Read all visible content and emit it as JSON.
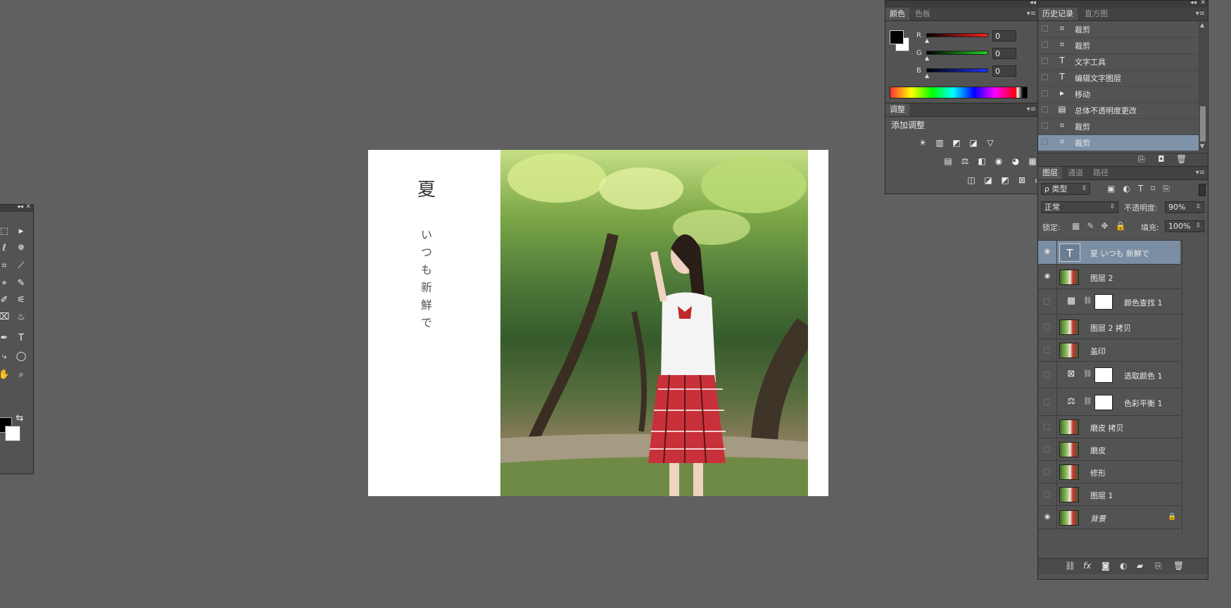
{
  "toolbar": {
    "tools": [
      "⬚",
      "▸",
      "ℓ",
      "✵",
      "⌗",
      "⟋",
      "⌖",
      "✎",
      "✐",
      "⚟",
      "⌧",
      "♨",
      "✒",
      "T",
      "⤷",
      "◯",
      "✋",
      "⌕",
      "⇆"
    ]
  },
  "canvas": {
    "title_char": "夏",
    "vertical_text": [
      "い",
      "つ",
      "も",
      "新",
      "鮮",
      "で"
    ]
  },
  "color_panel": {
    "tabs": [
      "颜色",
      "色板"
    ],
    "channels": [
      {
        "label": "R",
        "value": "0",
        "gradient": "#ff2020"
      },
      {
        "label": "G",
        "value": "0",
        "gradient": "#20d020"
      },
      {
        "label": "B",
        "value": "0",
        "gradient": "#2030ff"
      }
    ]
  },
  "adjustments_panel": {
    "tab": "调整",
    "header": "添加调整",
    "row1": [
      "☀",
      "▥",
      "◩",
      "◪",
      "▽"
    ],
    "row2": [
      "▤",
      "⚖",
      "◧",
      "◉",
      "◕",
      "▦"
    ],
    "row3": [
      "◫",
      "◪",
      "◩",
      "⊠",
      "▭"
    ]
  },
  "history_panel": {
    "tabs": [
      "历史记录",
      "直方图"
    ],
    "items": [
      {
        "icon": "crop-icon",
        "glyph": "⌗",
        "label": "裁剪",
        "selected": false
      },
      {
        "icon": "crop-icon",
        "glyph": "⌗",
        "label": "裁剪",
        "selected": false
      },
      {
        "icon": "text-icon",
        "glyph": "T",
        "label": "文字工具",
        "selected": false
      },
      {
        "icon": "text-icon",
        "glyph": "T",
        "label": "编辑文字图层",
        "selected": false
      },
      {
        "icon": "move-icon",
        "glyph": "▸",
        "label": "移动",
        "selected": false
      },
      {
        "icon": "document-icon",
        "glyph": "▤",
        "label": "总体不透明度更改",
        "selected": false
      },
      {
        "icon": "crop-icon",
        "glyph": "⌗",
        "label": "裁剪",
        "selected": false
      },
      {
        "icon": "crop-icon",
        "glyph": "⌗",
        "label": "裁剪",
        "selected": true
      }
    ]
  },
  "layers_panel": {
    "tabs": [
      "图层",
      "通道",
      "路径"
    ],
    "filter": "ρ 类型",
    "blend_mode": "正常",
    "opacity_label": "不透明度:",
    "opacity_value": "90%",
    "lock_label": "锁定:",
    "fill_label": "填充:",
    "fill_value": "100%",
    "layers": [
      {
        "name": "夏 いつも 新鮮で",
        "kind": "text",
        "visible": true,
        "selected": true
      },
      {
        "name": "图层 2",
        "kind": "pixel",
        "visible": true,
        "selected": false
      },
      {
        "name": "颜色查找 1",
        "kind": "adjustment",
        "glyph": "▦",
        "visible": false,
        "selected": false
      },
      {
        "name": "图层 2 拷贝",
        "kind": "pixel",
        "visible": false,
        "selected": false
      },
      {
        "name": "盖印",
        "kind": "pixel",
        "visible": false,
        "selected": false
      },
      {
        "name": "选取颜色 1",
        "kind": "adjustment",
        "glyph": "⊠",
        "visible": false,
        "selected": false
      },
      {
        "name": "色彩平衡 1",
        "kind": "adjustment",
        "glyph": "⚖",
        "visible": false,
        "selected": false
      },
      {
        "name": "磨皮 拷贝",
        "kind": "pixel",
        "visible": false,
        "selected": false
      },
      {
        "name": "磨皮",
        "kind": "pixel",
        "visible": false,
        "selected": false
      },
      {
        "name": "修形",
        "kind": "pixel",
        "visible": false,
        "selected": false
      },
      {
        "name": "图层 1",
        "kind": "pixel",
        "visible": false,
        "selected": false
      },
      {
        "name": "背景",
        "kind": "background",
        "visible": true,
        "selected": false,
        "locked": true
      }
    ]
  }
}
